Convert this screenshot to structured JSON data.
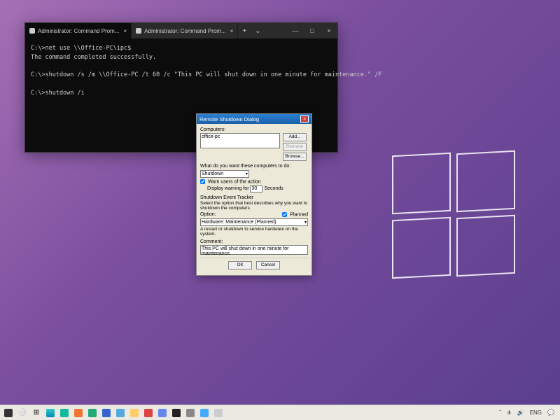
{
  "terminal": {
    "tabs": [
      {
        "label": "Administrator: Command Prom..."
      },
      {
        "label": "Administrator: Command Prom..."
      }
    ],
    "add": "+",
    "controls": {
      "min": "—",
      "max": "□",
      "close": "×"
    },
    "lines": "C:\\>net use \\\\Office-PC\\ipc$\nThe command completed successfully.\n\nC:\\>shutdown /s /m \\\\Office-PC /t 60 /c \"This PC will shut down in one minute for maintenance.\" /F\n\nC:\\>shutdown /i"
  },
  "dialog": {
    "title": "Remote Shutdown Dialog",
    "close": "×",
    "computers_label": "Computers:",
    "computers_value": "office-pc",
    "btn_add": "Add...",
    "btn_remove": "Remove",
    "btn_browse": "Browse...",
    "action_label": "What do you want these computers to do:",
    "action_value": "Shutdown",
    "warn_label": "Warn users of the action",
    "warn_display": "Display warning for",
    "warn_seconds_value": "30",
    "warn_seconds_unit": "Seconds",
    "tracker_title": "Shutdown Event Tracker",
    "tracker_desc": "Select the option that best describes why you want to shutdown the computers",
    "option_label": "Option:",
    "planned_label": "Planned",
    "option_value": "Hardware: Maintenance (Planned)",
    "option_desc": "A restart or shutdown to service hardware on the system.",
    "comment_label": "Comment:",
    "comment_value": "This PC will shut down in one minute for maintenance.",
    "ok": "OK",
    "cancel": "Cancel"
  },
  "taskbar": {
    "tray": {
      "up": "ˆ",
      "wifi": "⋔",
      "vol": "🔊",
      "lang": "ENG",
      "notif": "💬"
    }
  }
}
